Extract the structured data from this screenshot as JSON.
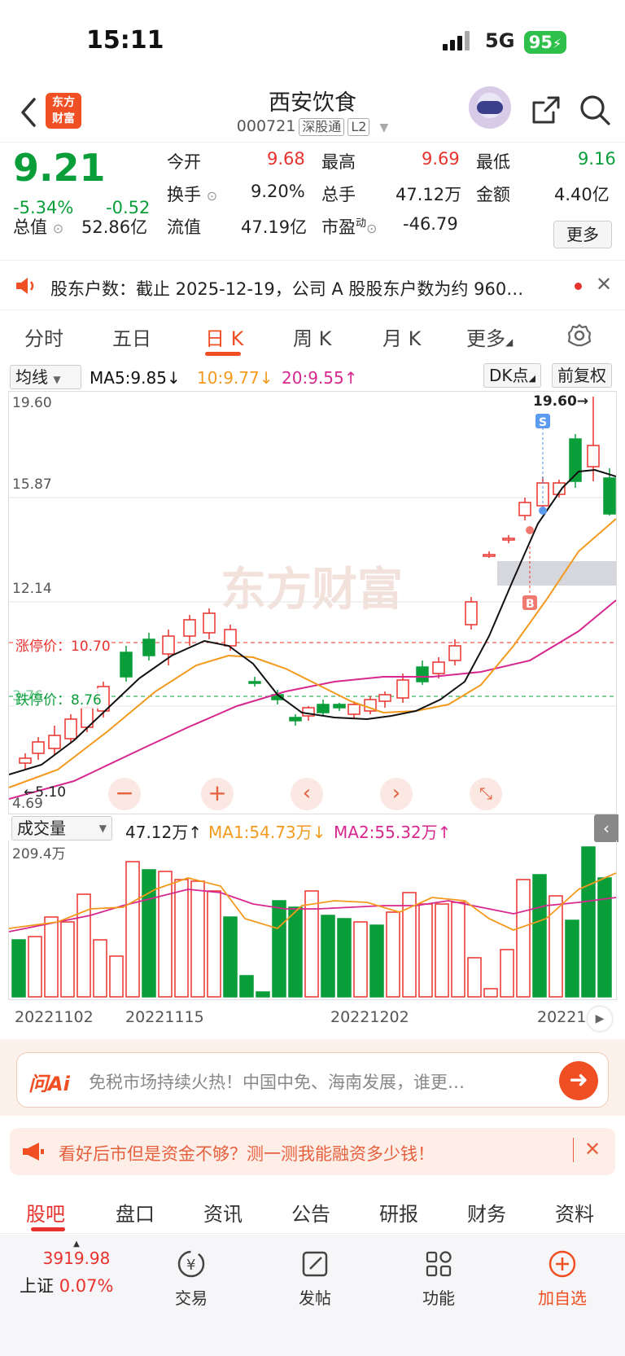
{
  "status": {
    "time": "15:11",
    "network": "5G",
    "battery": "95"
  },
  "header": {
    "logo_text": [
      "东方",
      "财富"
    ],
    "title": "西安饮食",
    "code": "000721",
    "tags": [
      "深股通",
      "L2"
    ]
  },
  "quote": {
    "price": "9.21",
    "change_pct": "-5.34%",
    "change": "-0.52",
    "open_label": "今开",
    "open": "9.68",
    "high_label": "最高",
    "high": "9.69",
    "low_label": "最低",
    "low": "9.16",
    "turnover_label": "换手",
    "turnover": "9.20%",
    "volume_label": "总手",
    "volume": "47.12万",
    "amount_label": "金额",
    "amount": "4.40亿",
    "mcap_label": "总值",
    "mcap": "52.86亿",
    "float_label": "流值",
    "float": "47.19亿",
    "pe_label": "市盈",
    "pe_sup": "动",
    "pe": "-46.79",
    "more": "更多"
  },
  "notice": {
    "text": "股东户数：截止 2025-12-19，公司 A 股股东户数为约 960…"
  },
  "tabs": {
    "items": [
      "分时",
      "五日",
      "日 K",
      "周 K",
      "月 K",
      "更多"
    ],
    "active": 2
  },
  "kline_header": {
    "selector": "均线",
    "ma5": "MA5:9.85",
    "ma10": "10:9.77",
    "ma20": "20:9.55",
    "dk": "DK点",
    "adj": "前复权"
  },
  "kline": {
    "price_labels": [
      "19.60",
      "15.87",
      "12.14",
      "4.69"
    ],
    "high_marker": "19.60→",
    "limit_up": "涨停价：10.70",
    "limit_down": "跌停价：8.76",
    "limit_down_overlay": "3.76",
    "low_marker": "5.10",
    "watermark": "东方财富",
    "sell_badge": "S",
    "buy_badge": "B"
  },
  "volume_header": {
    "selector": "成交量",
    "vol": "47.12万",
    "ma1": "MA1:54.73万",
    "ma2": "MA2:55.32万",
    "axis_max": "209.4万"
  },
  "dates": [
    "20221102",
    "20221115",
    "20221202",
    "20221"
  ],
  "ai": {
    "logo": "问Ai",
    "text": "免税市场持续火热！中国中免、海南发展，谁更…"
  },
  "ad": {
    "text": "看好后市但是资金不够？测一测我能融资多少钱！"
  },
  "bottom_tabs": {
    "items": [
      "股吧",
      "盘口",
      "资讯",
      "公告",
      "研报",
      "财务",
      "资料"
    ],
    "active": 0
  },
  "footer": {
    "index_value": "3919.98",
    "index_name": "上证",
    "index_pct": "0.07%",
    "items": [
      "交易",
      "发帖",
      "功能",
      "加自选"
    ]
  },
  "colors": {
    "green": "#0a9e3a",
    "red": "#e8322d",
    "accent": "#f04e23",
    "ma5": "#111111",
    "ma10": "#f39a1e",
    "ma20": "#d6288f"
  }
}
